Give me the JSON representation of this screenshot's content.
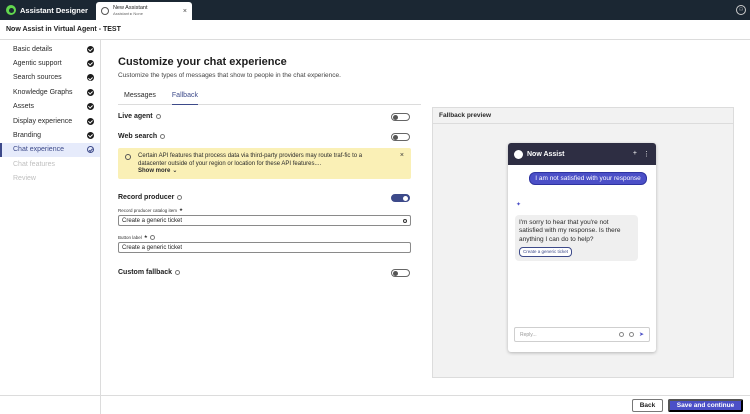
{
  "app": {
    "brand": "Assistant Designer",
    "tab": {
      "title": "New Assistant",
      "subtitle": "Assistant ▸ None",
      "close": "×"
    },
    "user_icon": "user-avatar-icon"
  },
  "page_title": "Now Assist in Virtual Agent - TEST",
  "sidebar": {
    "items": [
      {
        "label": "Basic details",
        "state": "done"
      },
      {
        "label": "Agentic support",
        "state": "done"
      },
      {
        "label": "Search sources",
        "state": "done"
      },
      {
        "label": "Knowledge Graphs",
        "state": "done"
      },
      {
        "label": "Assets",
        "state": "done"
      },
      {
        "label": "Display experience",
        "state": "done"
      },
      {
        "label": "Branding",
        "state": "done"
      },
      {
        "label": "Chat experience",
        "state": "active"
      },
      {
        "label": "Chat features",
        "state": "disabled"
      },
      {
        "label": "Review",
        "state": "disabled"
      }
    ]
  },
  "main": {
    "title": "Customize your chat experience",
    "subtitle": "Customize the types of messages that show to people in the chat experience.",
    "tabs": [
      {
        "label": "Messages",
        "active": false
      },
      {
        "label": "Fallback",
        "active": true
      }
    ],
    "live_agent": {
      "label": "Live agent",
      "enabled": false
    },
    "web_search": {
      "label": "Web search",
      "enabled": false
    },
    "warning": {
      "text": "Certain API features that process data via third-party providers may route traf-fic to a datacenter outside of your region or location for these API features....",
      "show_more": "Show more",
      "close": "×"
    },
    "record_producer": {
      "label": "Record producer",
      "enabled": true,
      "catalog_label": "Record producer catalog item",
      "catalog_required": "★",
      "catalog_value": "Create a generic ticket",
      "button_label": "Button label",
      "button_required": "★",
      "button_value": "Create a generic ticket"
    },
    "custom_fallback": {
      "label": "Custom fallback",
      "enabled": false
    }
  },
  "preview": {
    "heading": "Fallback preview",
    "chat_title": "Now Assist",
    "plus": "+",
    "menu": "⋮",
    "user_message": "I am not satisfied with your response",
    "sparkle": "✦",
    "bot_message": "I'm sorry to hear that you're not satisfied with my response. Is there anything I can do to help?",
    "bot_chip": "Create a generic ticket",
    "reply_placeholder": "Reply...",
    "send": "➤"
  },
  "footer": {
    "back": "Back",
    "save": "Save and continue"
  },
  "colors": {
    "topbar": "#1b2733",
    "accent": "#3d4a8a",
    "primary_button": "#4b4fc7",
    "warning_bg": "#faf0b6",
    "chat_header": "#2e2e43"
  }
}
